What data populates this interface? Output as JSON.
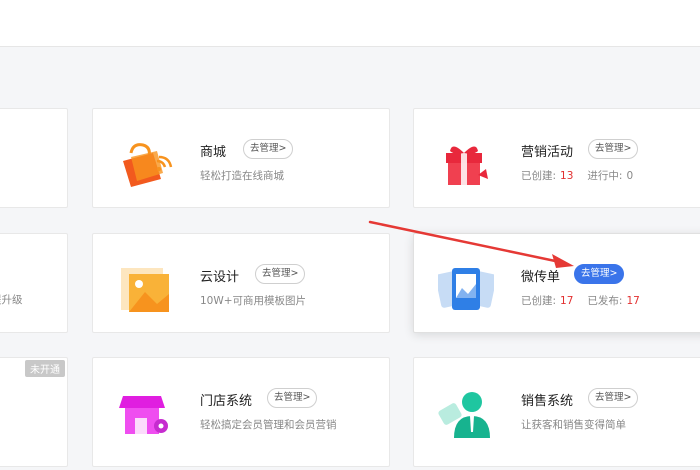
{
  "cards": {
    "mall": {
      "title": "商城",
      "manage_label": "去管理>",
      "desc": "轻松打造在线商城"
    },
    "marketing": {
      "title": "营销活动",
      "manage_label": "去管理>",
      "created_label": "已创建:",
      "created_count": "13",
      "running_label": "进行中:",
      "running_count": "0"
    },
    "cloud_design": {
      "title": "云设计",
      "manage_label": "去管理>",
      "desc": "10W+可商用模板图片"
    },
    "micro_flyer": {
      "title": "微传单",
      "manage_label": "去管理>",
      "created_label": "已创建:",
      "created_count": "17",
      "published_label": "已发布:",
      "published_count": "17"
    },
    "store_system": {
      "title": "门店系统",
      "manage_label": "去管理>",
      "desc": "轻松搞定会员管理和会员营销"
    },
    "sales_system": {
      "title": "销售系统",
      "manage_label": "去管理>",
      "desc": "让获客和销售变得简单"
    },
    "partial_left_middle": {
      "desc": "提升级"
    },
    "partial_left_bottom": {
      "badge": "未开通"
    }
  },
  "colors": {
    "accent": "#3a74ea",
    "stat": "#e23030",
    "arrow": "#e53935"
  }
}
